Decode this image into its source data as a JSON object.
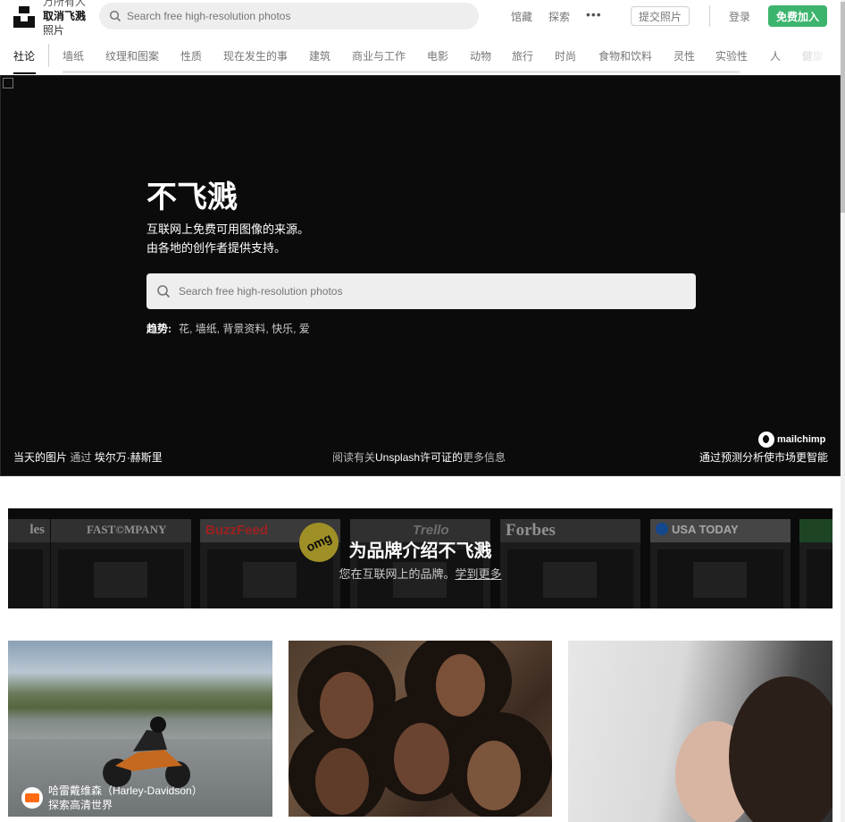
{
  "header": {
    "brand_lines": [
      "万所有人",
      "取消飞溅",
      "照片"
    ],
    "search_placeholder": "Search free high-resolution photos",
    "nav": [
      "馆藏",
      "探索"
    ],
    "more_label": "•••",
    "submit_label": "提交照片",
    "login_label": "登录",
    "join_label": "免费加入"
  },
  "tabs": [
    "社论",
    "墙纸",
    "纹理和图案",
    "性质",
    "现在发生的事",
    "建筑",
    "商业与工作",
    "电影",
    "动物",
    "旅行",
    "时尚",
    "食物和饮料",
    "灵性",
    "实验性",
    "人",
    "健康"
  ],
  "hero": {
    "title": "不飞溅",
    "subtitle_lines": [
      "互联网上免费可用图像的来源。",
      "由各地的创作者提供支持。"
    ],
    "search_placeholder": "Search free high-resolution photos",
    "trending_label": "趋势:",
    "trending": [
      "花",
      "墙纸",
      "背景资料",
      "快乐",
      "爱"
    ],
    "photo_of_day": "当天的图片",
    "by": "通过",
    "photographer": "埃尔万·赫斯里",
    "license_pre": "阅读有关",
    "license_strong": "Unsplash许可证的",
    "license_post": "更多信息",
    "sponsor_logo": "mailchimp",
    "sponsor_text": "通过预测分析使市场更智能"
  },
  "banner": {
    "brands": [
      "les",
      "FAST©MPANY",
      "BuzzFeed",
      "Trello",
      "Forbes",
      "USA TODAY"
    ],
    "omg_badge": "omg",
    "title": "为品牌介绍不飞溅",
    "subtitle": "您在互联网上的品牌。",
    "link": "学到更多"
  },
  "photos": {
    "credit_name": "哈雷戴维森（Harley-Davidson）",
    "credit_sub": "探索高清世界"
  }
}
